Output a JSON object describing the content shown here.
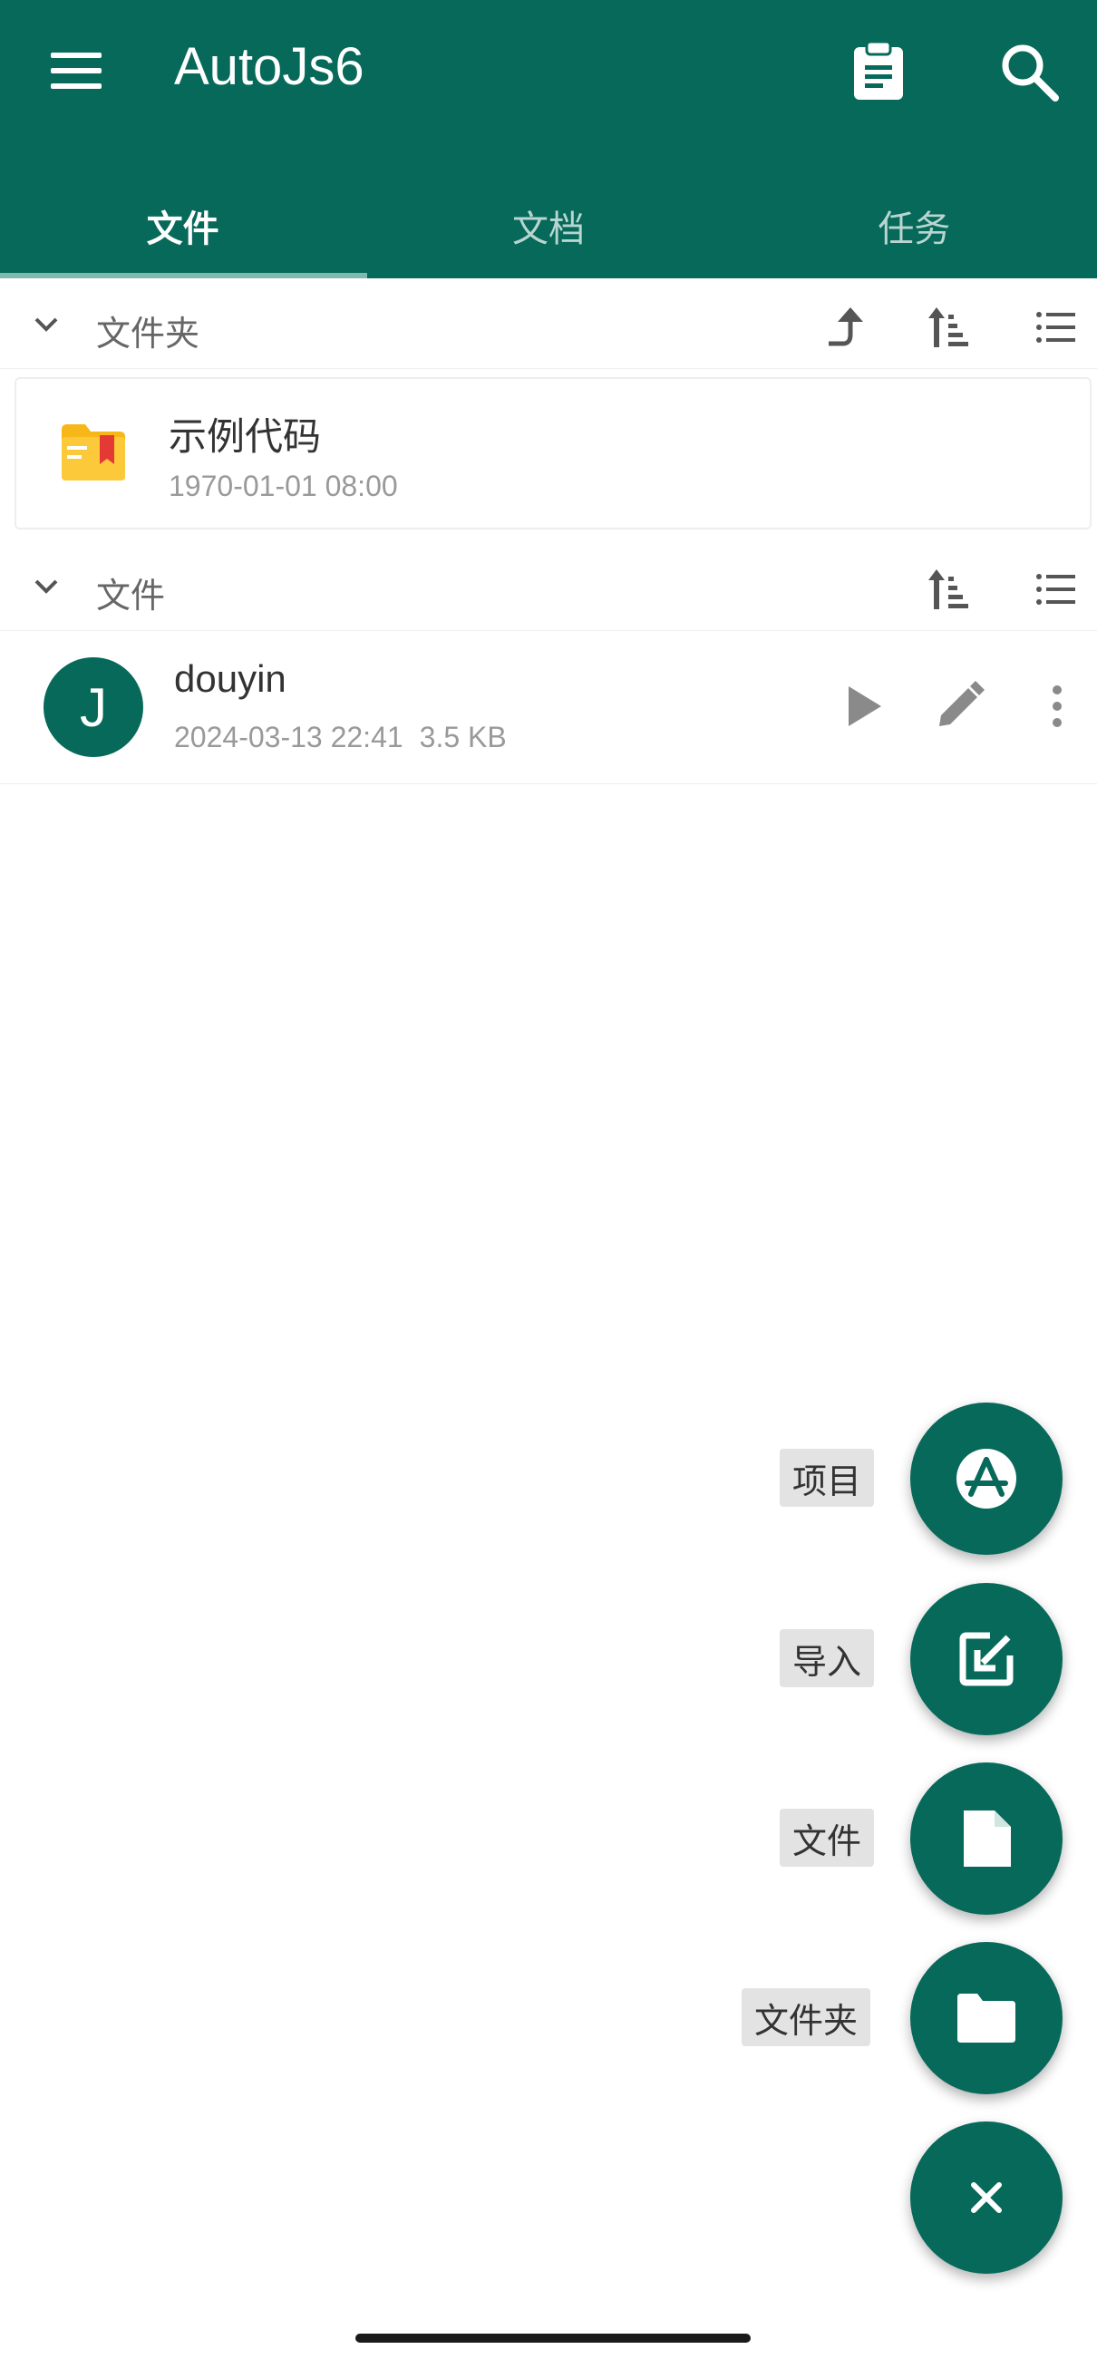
{
  "app_bar": {
    "title": "AutoJs6",
    "background": "#06695a",
    "icons": [
      "menu-icon",
      "clipboard-icon",
      "search-icon"
    ]
  },
  "tabs": [
    {
      "label": "文件",
      "active": true
    },
    {
      "label": "文档",
      "active": false
    },
    {
      "label": "任务",
      "active": false
    }
  ],
  "folders_section": {
    "label": "文件夹",
    "icons": [
      "chevron-down-icon",
      "go-up-icon",
      "sort-icon",
      "list-view-icon"
    ],
    "items": [
      {
        "name": "示例代码",
        "date": "1970-01-01 08:00"
      }
    ]
  },
  "files_section": {
    "label": "文件",
    "icons": [
      "chevron-down-icon",
      "sort-icon",
      "list-view-icon"
    ],
    "items": [
      {
        "avatar_letter": "J",
        "name": "douyin",
        "date": "2024-03-13 22:41",
        "size": "3.5 KB"
      }
    ]
  },
  "fab_menu": {
    "items": [
      {
        "label": "项目",
        "icon": "app-store-icon"
      },
      {
        "label": "导入",
        "icon": "import-icon"
      },
      {
        "label": "文件",
        "icon": "file-icon"
      },
      {
        "label": "文件夹",
        "icon": "folder-icon"
      }
    ],
    "close_icon": "close-icon"
  }
}
